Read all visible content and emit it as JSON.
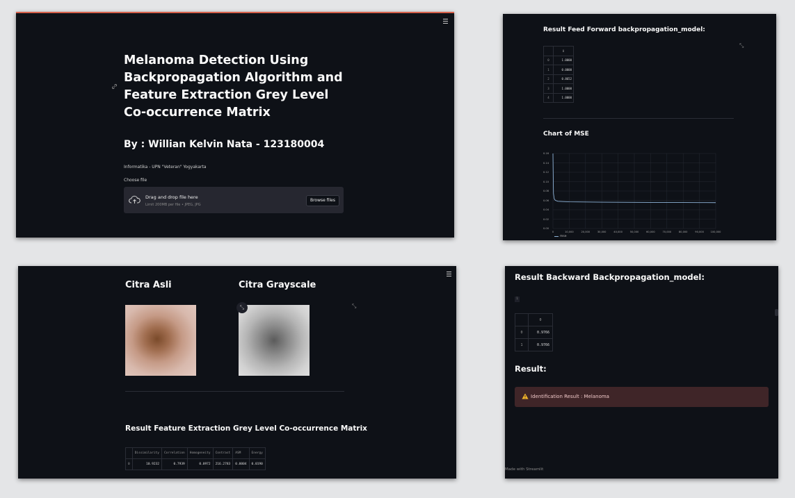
{
  "panel_top_left": {
    "title": "Melanoma Detection Using Backpropagation Algorithm and Feature Extraction Grey Level Co-occurrence Matrix",
    "author": "By : Willian Kelvin Nata - 123180004",
    "affiliation": "Informatika - UPN \"Veteran\" Yogyakarta",
    "uploader": {
      "label": "Choose file",
      "drag_text": "Drag and drop file here",
      "limit_text": "Limit 200MB per file • JPEG, JPG",
      "button": "Browse files",
      "icon": "cloud-upload-icon"
    },
    "menu_icon": "hamburger-menu-icon",
    "link_icon": "link-icon"
  },
  "panel_top_right": {
    "forward_title": "Result Feed Forward backpropagation_model:",
    "forward_table": {
      "header": "0",
      "rows": [
        {
          "index": "0",
          "value": "1.0000"
        },
        {
          "index": "1",
          "value": "0.0000"
        },
        {
          "index": "2",
          "value": "0.8652"
        },
        {
          "index": "3",
          "value": "1.0000"
        },
        {
          "index": "4",
          "value": "1.0000"
        }
      ]
    },
    "chart_title": "Chart of MSE",
    "legend_label": "mse"
  },
  "chart_data": {
    "type": "line",
    "title": "Chart of MSE",
    "xlabel": "",
    "ylabel": "",
    "x_ticks": [
      "0",
      "10,000",
      "20,000",
      "30,000",
      "40,000",
      "50,000",
      "60,000",
      "70,000",
      "80,000",
      "90,000",
      "100,000"
    ],
    "y_ticks": [
      "0.00",
      "0.02",
      "0.04",
      "0.06",
      "0.08",
      "0.10",
      "0.12",
      "0.14",
      "0.16"
    ],
    "xlim": [
      0,
      100000
    ],
    "ylim": [
      0,
      0.16
    ],
    "grid": true,
    "series": [
      {
        "name": "mse",
        "color": "#8fb4d9",
        "x": [
          0,
          300,
          800,
          1500,
          3000,
          6000,
          10000,
          20000,
          30000,
          40000,
          50000,
          60000,
          70000,
          80000,
          90000,
          100000
        ],
        "y": [
          0.16,
          0.075,
          0.063,
          0.06,
          0.058,
          0.0575,
          0.057,
          0.0565,
          0.0562,
          0.056,
          0.0558,
          0.0557,
          0.0555,
          0.0554,
          0.0553,
          0.0552
        ]
      }
    ]
  },
  "panel_bottom_left": {
    "original_title": "Citra Asli",
    "grayscale_title": "Citra Grayscale",
    "glcm_title": "Result Feature Extraction Grey Level Co-occurrence Matrix",
    "glcm_table": {
      "headers": [
        "",
        "Dissimilarity",
        "Correlation",
        "Homogeneity",
        "Contrast",
        "ASM",
        "Energy"
      ],
      "rows": [
        [
          "0",
          "10.9232",
          "0.7939",
          "0.0972",
          "216.2783",
          "0.0004",
          "0.0190"
        ]
      ]
    }
  },
  "panel_bottom_right": {
    "backward_title": "Result Backward Backpropagation_model:",
    "small_badge": "1",
    "backward_table": {
      "header": "0",
      "rows": [
        {
          "index": "0",
          "value": "0.9766"
        },
        {
          "index": "1",
          "value": "0.9766"
        }
      ]
    },
    "result_title": "Result:",
    "alert_text": "Identification Result : Melanoma",
    "alert_icon": "warning-icon",
    "footer": "Made with Streamlit"
  },
  "colors": {
    "background": "#0e1117",
    "page": "#e4e5e7",
    "alert_bg": "#3f2528",
    "accent": "#d7604a"
  }
}
